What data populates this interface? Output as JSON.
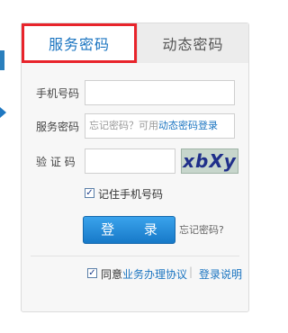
{
  "tabs": {
    "service_password": "服务密码",
    "dynamic_password": "动态密码"
  },
  "form": {
    "phone_label": "手机号码",
    "phone_value": "",
    "service_password_label": "服务密码",
    "service_password_hint": "忘记密码？可用",
    "service_password_hint_link": "动态密码登录",
    "captcha_label": "验 证 码",
    "captcha_value": "",
    "captcha_text": "xbXy",
    "remember_label": "记住手机号码",
    "login_button": "登  录",
    "forgot_password": "忘记密码?"
  },
  "footer": {
    "agree_prefix": "同意",
    "agreement_link": "业务办理协议",
    "separator": "|",
    "login_help": "登录说明"
  },
  "colors": {
    "accent": "#1a74c0",
    "active_tab_border": "#e8242b"
  }
}
